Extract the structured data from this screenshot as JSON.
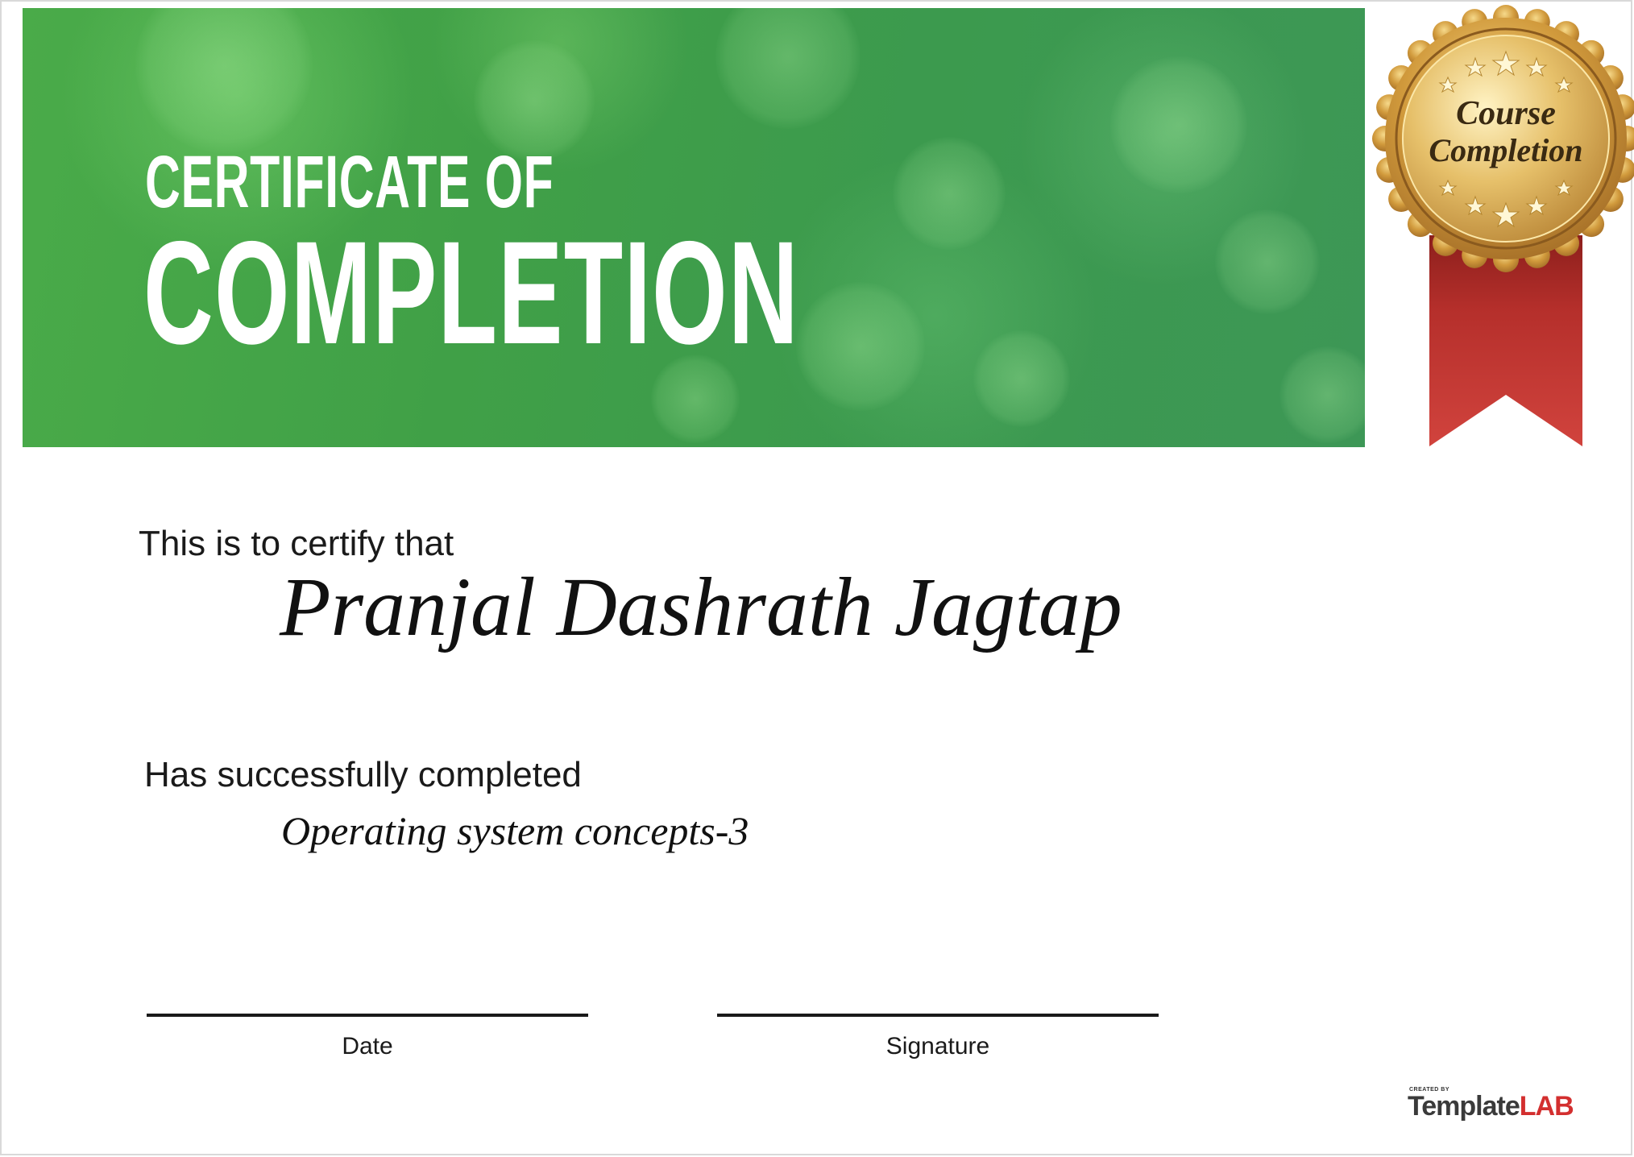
{
  "banner": {
    "title_line1": "CERTIFICATE OF",
    "title_line2": "COMPLETION"
  },
  "seal": {
    "line1": "Course",
    "line2": "Completion"
  },
  "body": {
    "certify_text": "This is to certify that",
    "recipient_name": "Pranjal Dashrath Jagtap",
    "completed_text": "Has successfully completed",
    "course_name": "Operating system concepts-3"
  },
  "footer": {
    "date_label": "Date",
    "signature_label": "Signature"
  },
  "brand": {
    "created_by": "CREATED BY",
    "name_part1": "Template",
    "name_part2": "LAB"
  },
  "colors": {
    "banner_green": "#40a047",
    "gold": "#c9973a",
    "ribbon_red": "#b8302c",
    "brand_red": "#d32f2f"
  }
}
